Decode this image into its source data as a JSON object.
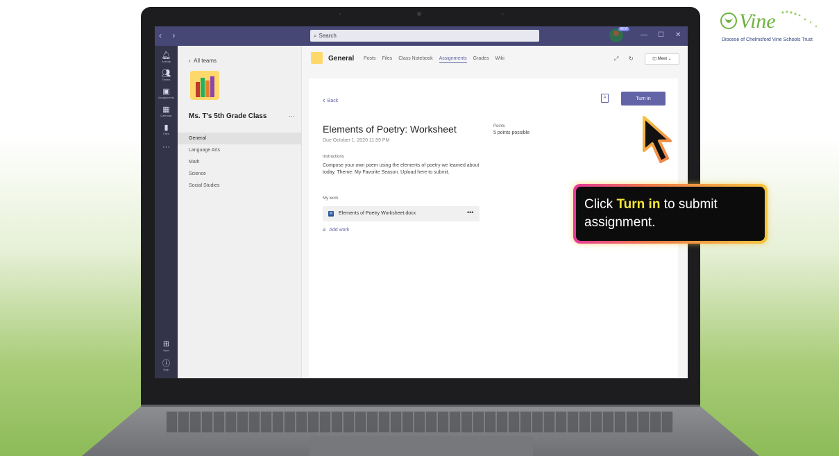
{
  "logo": {
    "word": "Vine",
    "subtitle": "Diocese of Chelmsford Vine Schools Trust"
  },
  "window": {
    "nav_arrows": "‹ ›",
    "search_placeholder": "Search",
    "avatar_badge": "NEW",
    "minimize": "—",
    "maximize": "☐",
    "close": "✕"
  },
  "rail": [
    {
      "label": "Activity",
      "icon": "bell-icon"
    },
    {
      "label": "Teams",
      "icon": "teams-icon"
    },
    {
      "label": "Assignments",
      "icon": "backpack-icon"
    },
    {
      "label": "Calendar",
      "icon": "calendar-icon"
    },
    {
      "label": "Files",
      "icon": "file-icon"
    },
    {
      "label": "",
      "icon": "more-icon"
    },
    {
      "label": "Apps",
      "icon": "apps-icon"
    },
    {
      "label": "Help",
      "icon": "help-icon"
    }
  ],
  "teams_panel": {
    "back_label": "All teams",
    "team_name": "Ms. T's 5th Grade Class",
    "more": "···",
    "channels": [
      "General",
      "Language Arts",
      "Math",
      "Science",
      "Social Studies"
    ]
  },
  "channel": {
    "title": "General",
    "tabs": [
      "Posts",
      "Files",
      "Class Notebook",
      "Assignments",
      "Grades",
      "Wiki"
    ],
    "active_tab": "Assignments",
    "meet_label": "Meet"
  },
  "assignment": {
    "back_label": "Back",
    "turn_in_label": "Turn in",
    "title": "Elements of Poetry: Worksheet",
    "due": "Due October 1, 2020 11:59 PM",
    "points_label": "Points",
    "points_value": "5 points possible",
    "instructions_label": "Instructions",
    "instructions": "Compose your own poem using the elements of poetry we learned about today. Theme: My Favorite Season. Upload here to submit.",
    "my_work_label": "My work",
    "file_name": "Elements of Poetry Worksheet.docx",
    "file_more": "•••",
    "add_work_label": "Add work"
  },
  "callout": {
    "prefix": "Click ",
    "highlight": "Turn in",
    "suffix": " to submit assignment."
  },
  "colors": {
    "teams_purple": "#6264a7",
    "titlebar": "#464775",
    "rail": "#33344a",
    "vine_green": "#6db33f",
    "callout_highlight": "#f5e53b"
  }
}
